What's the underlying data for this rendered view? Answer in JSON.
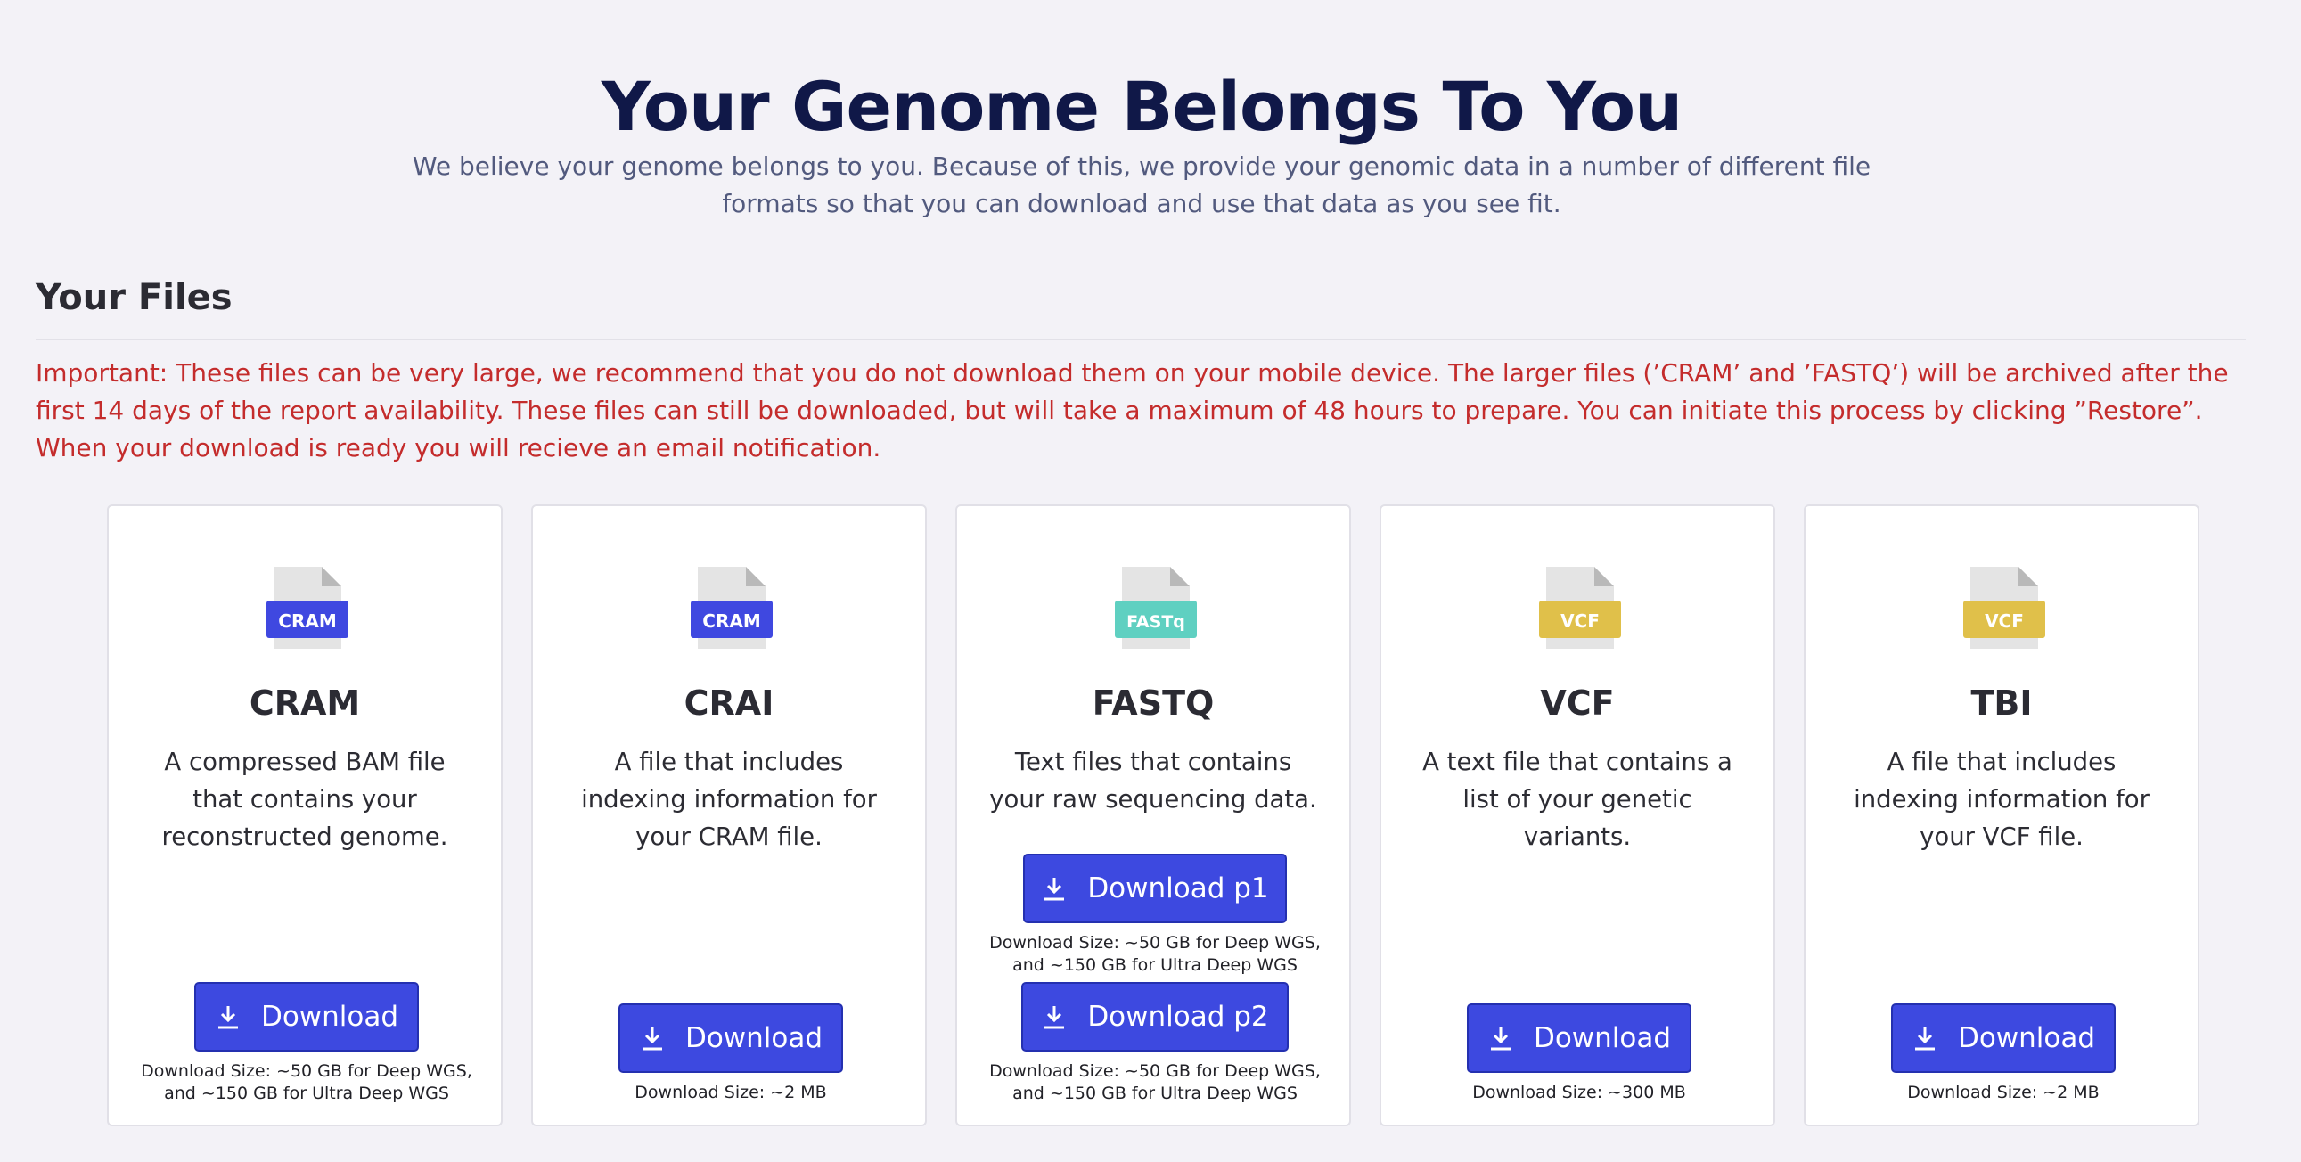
{
  "header": {
    "title": "Your Genome Belongs To You",
    "subtitle": "We believe your genome belongs to you. Because of this, we provide your genomic data in a number of different file formats so that you can download and use that data as you see fit."
  },
  "files_section": {
    "title": "Your Files",
    "notice_label": "Important:",
    "notice_text": " These files can be very large, we recommend that you do not download them on your mobile device. The larger files (’CRAM’ and ’FASTQ’) will be archived after the first 14 days of the report availability. These files can still be downloaded, but will take a maximum of 48 hours to prepare. You can initiate this process by clicking ”Restore”. When your download is ready you will recieve an email notification."
  },
  "colors": {
    "primary_button": "#3d49e0",
    "cram_badge": "#3f48e0",
    "fastq_badge": "#5fd0c1",
    "vcf_badge": "#e0c04a",
    "notice": "#c42c2c",
    "title": "#101848"
  },
  "cards": [
    {
      "icon": "cram-file-icon",
      "badge": "CRAM",
      "title": "CRAM",
      "description": "A compressed BAM file that contains your reconstructed genome.",
      "buttons": [
        {
          "label": "Download",
          "size": "Download Size: ~50 GB for Deep WGS, and ~150 GB for Ultra Deep WGS"
        }
      ]
    },
    {
      "icon": "cram-file-icon",
      "badge": "CRAM",
      "title": "CRAI",
      "description": "A file that includes indexing information for your CRAM file.",
      "buttons": [
        {
          "label": "Download",
          "size": "Download Size: ~2 MB"
        }
      ]
    },
    {
      "icon": "fastq-file-icon",
      "badge": "FASTq",
      "title": "FASTQ",
      "description": "Text files that contains your raw sequencing data.",
      "buttons": [
        {
          "label": "Download p1",
          "size": "Download Size: ~50 GB for Deep WGS, and ~150 GB for Ultra Deep WGS"
        },
        {
          "label": "Download p2",
          "size": "Download Size: ~50 GB for Deep WGS, and ~150 GB for Ultra Deep WGS"
        }
      ]
    },
    {
      "icon": "vcf-file-icon",
      "badge": "VCF",
      "title": "VCF",
      "description": "A text file that contains a list of your genetic variants.",
      "buttons": [
        {
          "label": "Download",
          "size": "Download Size: ~300 MB"
        }
      ]
    },
    {
      "icon": "vcf-file-icon",
      "badge": "VCF",
      "title": "TBI",
      "description": "A file that includes indexing information for your VCF file.",
      "buttons": [
        {
          "label": "Download",
          "size": "Download Size: ~2 MB"
        }
      ]
    }
  ]
}
